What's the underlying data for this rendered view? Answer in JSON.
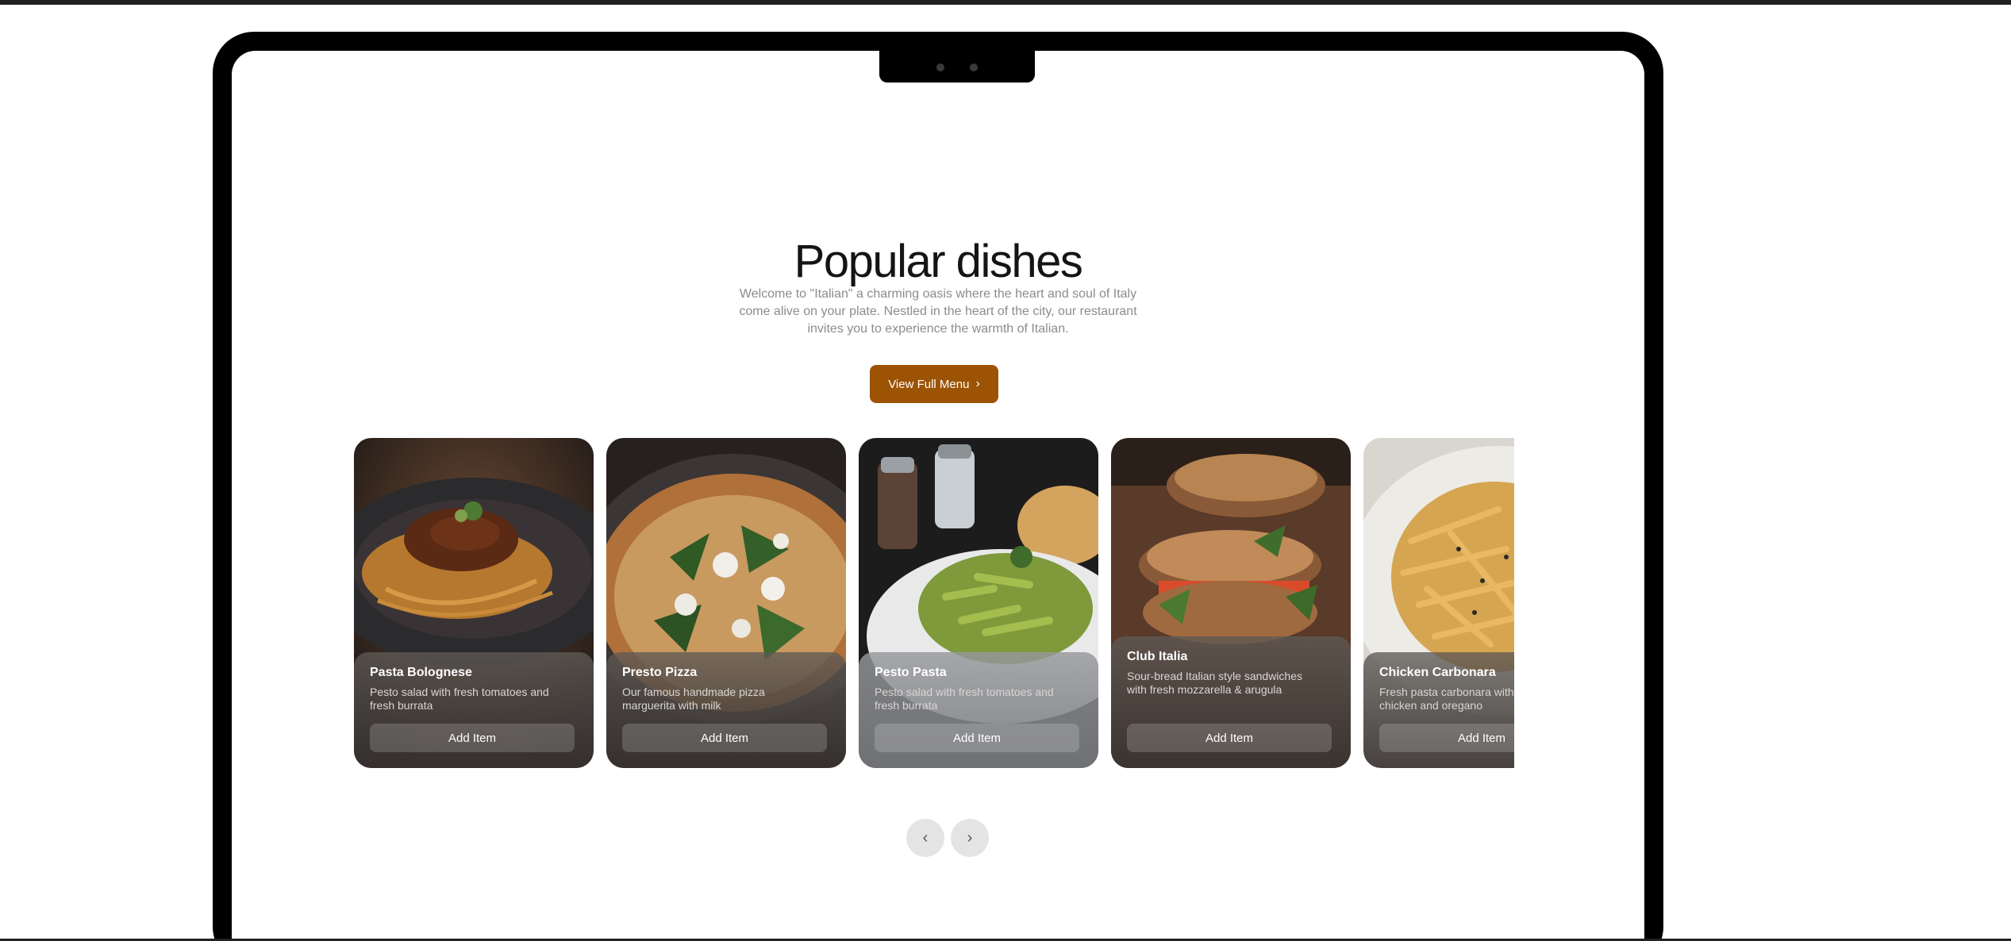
{
  "section": {
    "title": "Popular dishes",
    "description": "Welcome to \"Italian\" a charming oasis where the heart and soul of Italy come alive on your plate. Nestled in the heart of the city, our restaurant invites you to experience the warmth of Italian.",
    "cta_label": "View Full Menu",
    "cta_icon": "chevron-right-icon",
    "accent_color": "#9d5304"
  },
  "cards": [
    {
      "title": "Pasta Bolognese",
      "desc": "Pesto salad with fresh tomatoes and fresh burrata",
      "button": "Add Item"
    },
    {
      "title": "Presto Pizza",
      "desc": "Our famous handmade pizza marguerita with milk",
      "button": "Add Item"
    },
    {
      "title": "Pesto Pasta",
      "desc": "Pesto salad with fresh tomatoes and fresh burrata",
      "button": "Add Item"
    },
    {
      "title": "Club Italia",
      "desc": "Sour-bread Italian style sandwiches with fresh mozzarella & arugula",
      "button": "Add Item"
    },
    {
      "title": "Chicken Carbonara",
      "desc": "Fresh pasta carbonara with tender chicken and oregano",
      "button": "Add Item"
    }
  ],
  "carousel_nav": {
    "prev_icon": "chevron-left-icon",
    "next_icon": "chevron-right-icon",
    "prev_glyph": "‹",
    "next_glyph": "›"
  }
}
